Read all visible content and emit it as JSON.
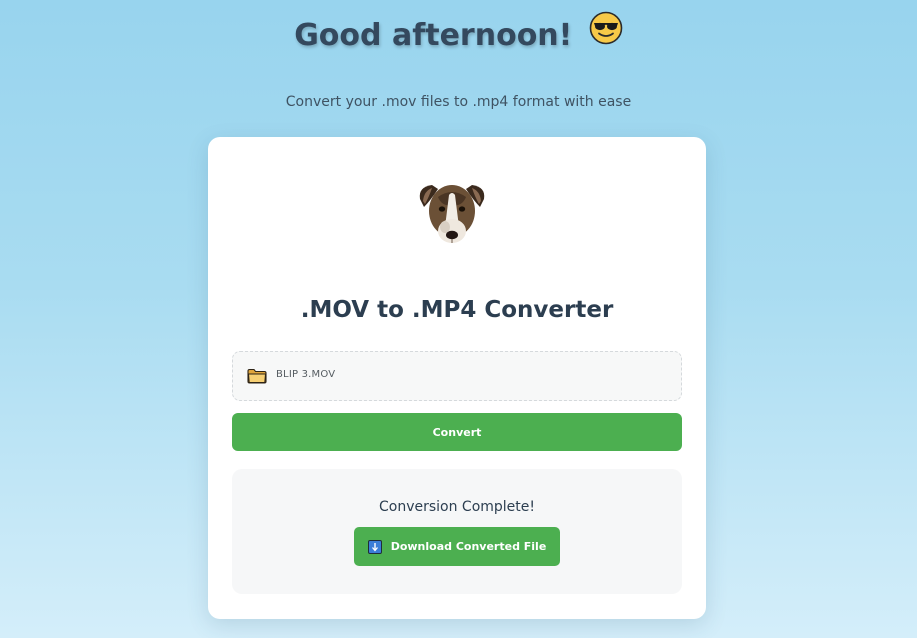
{
  "header": {
    "greeting": "Good afternoon!",
    "greeting_emoji": "smiling-face-with-sunglasses-icon",
    "subtitle": "Convert your .mov files to .mp4 format with ease"
  },
  "card": {
    "mascot": "dog-head-icon",
    "title": ".MOV to .MP4 Converter",
    "file_input": {
      "icon": "folder-icon",
      "selected_file": "BLIP 3.MOV"
    },
    "convert_label": "Convert",
    "result": {
      "status_text": "Conversion Complete!",
      "download_icon": "download-arrow-icon",
      "download_label": "Download Converted File"
    }
  },
  "colors": {
    "accent_green": "#4caf50",
    "title_text": "#2c3e50",
    "background_top": "#98d4ee",
    "background_bottom": "#d4eefa"
  }
}
